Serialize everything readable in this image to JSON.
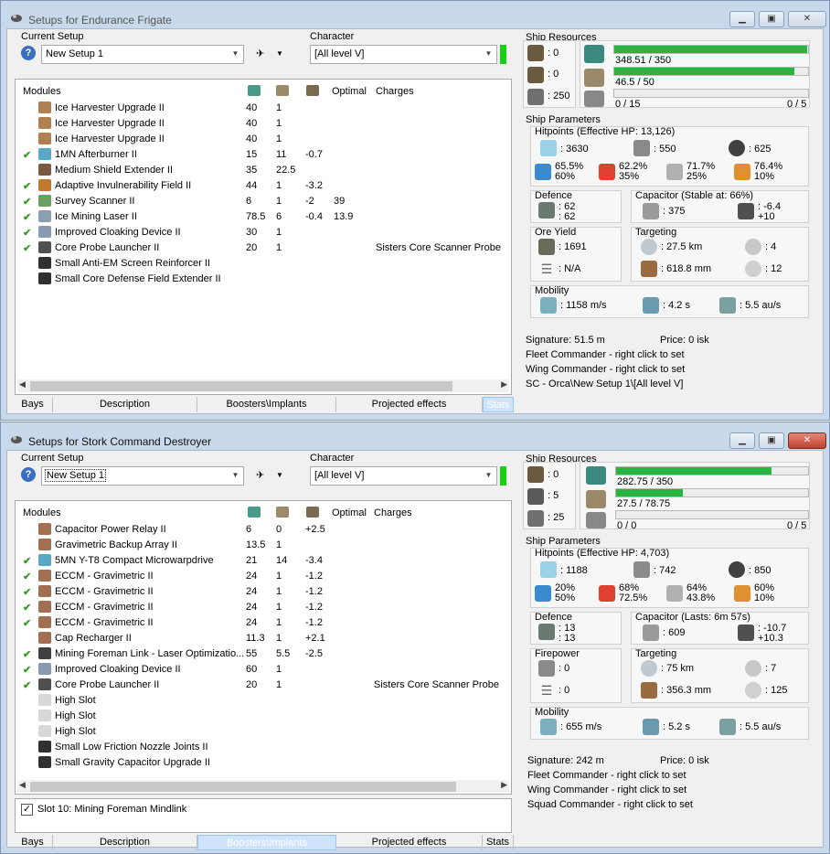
{
  "w1": {
    "title": "Setups for Endurance Frigate",
    "current_setup_label": "Current Setup",
    "setup_value": "New Setup 1",
    "character_label": "Character",
    "character_value": "[All level V]",
    "headers": {
      "modules": "Modules",
      "optimal": "Optimal",
      "charges": "Charges"
    },
    "modules": [
      {
        "check": "",
        "name": "Ice Harvester Upgrade II",
        "cpu": "40",
        "pg": "1",
        "cap": "",
        "opt": "",
        "charge": "",
        "color": "#b08050"
      },
      {
        "check": "",
        "name": "Ice Harvester Upgrade II",
        "cpu": "40",
        "pg": "1",
        "cap": "",
        "opt": "",
        "charge": "",
        "color": "#b08050"
      },
      {
        "check": "",
        "name": "Ice Harvester Upgrade II",
        "cpu": "40",
        "pg": "1",
        "cap": "",
        "opt": "",
        "charge": "",
        "color": "#b08050"
      },
      {
        "check": "✔",
        "name": "1MN Afterburner II",
        "cpu": "15",
        "pg": "11",
        "cap": "-0.7",
        "opt": "",
        "charge": "",
        "color": "#5aa8c8"
      },
      {
        "check": "",
        "name": "Medium Shield Extender II",
        "cpu": "35",
        "pg": "22.5",
        "cap": "",
        "opt": "",
        "charge": "",
        "color": "#7a5a40"
      },
      {
        "check": "✔",
        "name": "Adaptive Invulnerability Field II",
        "cpu": "44",
        "pg": "1",
        "cap": "-3.2",
        "opt": "",
        "charge": "",
        "color": "#c07a30"
      },
      {
        "check": "✔",
        "name": "Survey Scanner II",
        "cpu": "6",
        "pg": "1",
        "cap": "-2",
        "opt": "39",
        "charge": "",
        "color": "#6aa060"
      },
      {
        "check": "✔",
        "name": "Ice Mining Laser II",
        "cpu": "78.5",
        "pg": "6",
        "cap": "-0.4",
        "opt": "13.9",
        "charge": "",
        "color": "#8aa0b0"
      },
      {
        "check": "✔",
        "name": "Improved Cloaking Device II",
        "cpu": "30",
        "pg": "1",
        "cap": "",
        "opt": "",
        "charge": "",
        "color": "#8a9ab0"
      },
      {
        "check": "✔",
        "name": "Core Probe Launcher II",
        "cpu": "20",
        "pg": "1",
        "cap": "",
        "opt": "",
        "charge": "Sisters Core Scanner Probe",
        "color": "#505050"
      },
      {
        "check": "",
        "name": "Small Anti-EM Screen Reinforcer II",
        "cpu": "",
        "pg": "",
        "cap": "",
        "opt": "",
        "charge": "",
        "color": "#303030"
      },
      {
        "check": "",
        "name": "Small Core Defense Field Extender II",
        "cpu": "",
        "pg": "",
        "cap": "",
        "opt": "",
        "charge": "",
        "color": "#303030"
      }
    ],
    "tabs": [
      "Bays",
      "Description",
      "Boosters\\Implants",
      "Projected effects",
      "Stats"
    ],
    "active_tab": "4",
    "res": {
      "title": "Ship Resources",
      "t1": ": 0",
      "t2": ": 0",
      "t3": ": 250",
      "cpu": "348.51 / 350",
      "pg": "46.5 / 50",
      "cal": "0 / 15",
      "drones": "0 / 5",
      "cpu_fill": "0.9957",
      "pg_fill": "0.93",
      "cal_fill": "0"
    },
    "params": {
      "title": "Ship Parameters",
      "hp": "Hitpoints (Effective HP: 13,126)",
      "shield": ": 3630",
      "armor": ": 550",
      "hull": ": 625",
      "r1a": "65.5%",
      "r1b": "60%",
      "r2a": "62.2%",
      "r2b": "35%",
      "r3a": "71.7%",
      "r3b": "25%",
      "r4a": "76.4%",
      "r4b": "10%",
      "def_title": "Defence",
      "def1": ": 62",
      "def2": ": 62",
      "cap_title": "Capacitor (Stable at: 66%)",
      "cap_val": ": 375",
      "cap_a": ": -6.4",
      "cap_b": "+10",
      "ore_title": "Ore Yield",
      "ore1": ": 1691",
      "ore2": ": N/A",
      "tgt_title": "Targeting",
      "tgt_range": ": 27.5 km",
      "tgt_num": ": 4",
      "tgt_scan": ": 618.8 mm",
      "tgt_sig": ": 12",
      "mob_title": "Mobility",
      "speed": ": 1158 m/s",
      "align": ": 4.2 s",
      "warp": ": 5.5 au/s",
      "sig": "Signature: 51.5 m",
      "price": "Price: 0 isk",
      "fc": "Fleet Commander - right click to set",
      "wc": "Wing Commander - right click to set",
      "sc": "SC - Orca\\New Setup 1\\[All level V]"
    }
  },
  "w2": {
    "title": "Setups for Stork Command Destroyer",
    "current_setup_label": "Current Setup",
    "setup_value": "New Setup 1",
    "character_label": "Character",
    "character_value": "[All level V]",
    "headers": {
      "modules": "Modules",
      "optimal": "Optimal",
      "charges": "Charges"
    },
    "modules": [
      {
        "check": "",
        "name": "Capacitor Power Relay II",
        "cpu": "6",
        "pg": "0",
        "cap": "+2.5",
        "charge": "",
        "color": "#a07050"
      },
      {
        "check": "",
        "name": "Gravimetric Backup Array II",
        "cpu": "13.5",
        "pg": "1",
        "cap": "",
        "charge": "",
        "color": "#a07050"
      },
      {
        "check": "✔",
        "name": "5MN Y-T8 Compact Microwarpdrive",
        "cpu": "21",
        "pg": "14",
        "cap": "-3.4",
        "charge": "",
        "color": "#5aa8c8"
      },
      {
        "check": "✔",
        "name": "ECCM - Gravimetric II",
        "cpu": "24",
        "pg": "1",
        "cap": "-1.2",
        "charge": "",
        "color": "#a07050"
      },
      {
        "check": "✔",
        "name": "ECCM - Gravimetric II",
        "cpu": "24",
        "pg": "1",
        "cap": "-1.2",
        "charge": "",
        "color": "#a07050"
      },
      {
        "check": "✔",
        "name": "ECCM - Gravimetric II",
        "cpu": "24",
        "pg": "1",
        "cap": "-1.2",
        "charge": "",
        "color": "#a07050"
      },
      {
        "check": "✔",
        "name": "ECCM - Gravimetric II",
        "cpu": "24",
        "pg": "1",
        "cap": "-1.2",
        "charge": "",
        "color": "#a07050"
      },
      {
        "check": "",
        "name": "Cap Recharger II",
        "cpu": "11.3",
        "pg": "1",
        "cap": "+2.1",
        "charge": "",
        "color": "#a07050"
      },
      {
        "check": "✔",
        "name": "Mining Foreman Link - Laser Optimizatio...",
        "cpu": "55",
        "pg": "5.5",
        "cap": "-2.5",
        "charge": "",
        "color": "#404040"
      },
      {
        "check": "✔",
        "name": "Improved Cloaking Device II",
        "cpu": "60",
        "pg": "1",
        "cap": "",
        "charge": "",
        "color": "#8a9ab0"
      },
      {
        "check": "✔",
        "name": "Core Probe Launcher II",
        "cpu": "20",
        "pg": "1",
        "cap": "",
        "charge": "Sisters Core Scanner Probe",
        "color": "#505050"
      },
      {
        "check": "",
        "name": "High Slot",
        "cpu": "",
        "pg": "",
        "cap": "",
        "charge": "",
        "color": "#d8d8d8"
      },
      {
        "check": "",
        "name": "High Slot",
        "cpu": "",
        "pg": "",
        "cap": "",
        "charge": "",
        "color": "#d8d8d8"
      },
      {
        "check": "",
        "name": "High Slot",
        "cpu": "",
        "pg": "",
        "cap": "",
        "charge": "",
        "color": "#d8d8d8"
      },
      {
        "check": "",
        "name": "Small Low Friction Nozzle Joints II",
        "cpu": "",
        "pg": "",
        "cap": "",
        "charge": "",
        "color": "#303030"
      },
      {
        "check": "",
        "name": "Small Gravity Capacitor Upgrade II",
        "cpu": "",
        "pg": "",
        "cap": "",
        "charge": "",
        "color": "#303030"
      }
    ],
    "mindlink": "Slot 10: Mining Foreman Mindlink",
    "tabs": [
      "Bays",
      "Description",
      "Boosters\\Implants",
      "Projected effects",
      "Stats"
    ],
    "active_tab": "2",
    "res": {
      "title": "Ship Resources",
      "t1": ": 0",
      "t2": ": 5",
      "t3": ": 25",
      "cpu": "282.75 / 350",
      "pg": "27.5 / 78.75",
      "cal": "0 / 0",
      "drones": "0 / 5",
      "cpu_fill": "0.8079",
      "pg_fill": "0.3492",
      "cal_fill": "0"
    },
    "params": {
      "title": "Ship Parameters",
      "hp": "Hitpoints (Effective HP: 4,703)",
      "shield": ": 1188",
      "armor": ": 742",
      "hull": ": 850",
      "r1a": "20%",
      "r1b": "50%",
      "r2a": "68%",
      "r2b": "72.5%",
      "r3a": "64%",
      "r3b": "43.8%",
      "r4a": "60%",
      "r4b": "10%",
      "def_title": "Defence",
      "def1": ": 13",
      "def2": ": 13",
      "cap_title": "Capacitor (Lasts: 6m 57s)",
      "cap_val": ": 609",
      "cap_a": ": -10.7",
      "cap_b": "+10.3",
      "fp_title": "Firepower",
      "fp1": ": 0",
      "fp2": ": 0",
      "tgt_title": "Targeting",
      "tgt_range": ": 75 km",
      "tgt_num": ": 7",
      "tgt_scan": ": 356.3 mm",
      "tgt_sig": ": 125",
      "mob_title": "Mobility",
      "speed": ": 655 m/s",
      "align": ": 5.2 s",
      "warp": ": 5.5 au/s",
      "sig": "Signature: 242 m",
      "price": "Price: 0 isk",
      "fc": "Fleet Commander - right click to set",
      "wc": "Wing Commander - right click to set",
      "sqc": "Squad Commander - right click to set"
    }
  }
}
